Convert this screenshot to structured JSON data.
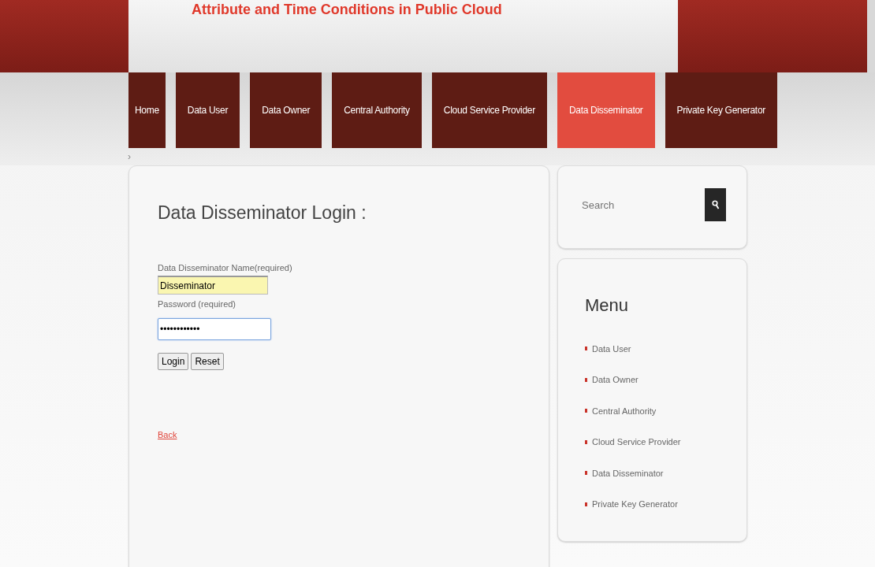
{
  "header": {
    "title": "Attribute and Time Conditions in Public Cloud"
  },
  "nav": [
    {
      "label": "Home",
      "selected": false
    },
    {
      "label": "Data User",
      "selected": false
    },
    {
      "label": "Data Owner",
      "selected": false
    },
    {
      "label": "Central Authority",
      "selected": false
    },
    {
      "label": "Cloud Service Provider",
      "selected": false
    },
    {
      "label": "Data Disseminator",
      "selected": true
    },
    {
      "label": "Private Key Generator",
      "selected": false
    }
  ],
  "breadcrumb": "›",
  "login": {
    "title": "Data Disseminator Login :",
    "name_label": "Data Disseminator Name(required)",
    "name_value": "Disseminator",
    "password_label": "Password (required)",
    "password_value": "••••••••••••",
    "buttons": [
      "Login",
      "Reset"
    ],
    "back_link": "Back"
  },
  "search": {
    "placeholder": "Search"
  },
  "menu": {
    "title": "Menu",
    "items": [
      "Data User",
      "Data Owner",
      "Central Authority",
      "Cloud Service Provider",
      "Data Disseminator",
      "Private Key Generator"
    ]
  }
}
